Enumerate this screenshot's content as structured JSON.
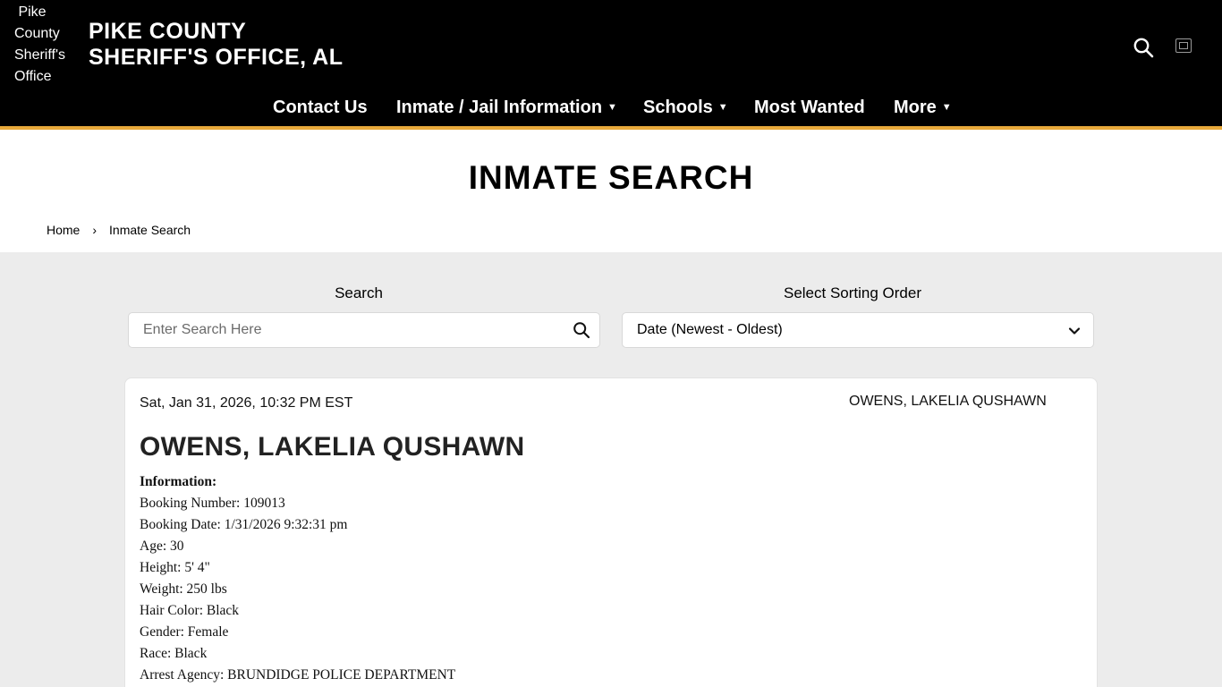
{
  "header": {
    "logo_alt": "Pike County Sheriff's Office",
    "title_line1": "PIKE COUNTY",
    "title_line2": "SHERIFF'S OFFICE, AL",
    "accent_color": "#e8a93a",
    "icons": [
      "search-icon",
      "broken-image-icon"
    ]
  },
  "nav": {
    "items": [
      {
        "label": "Contact Us",
        "has_dropdown": false
      },
      {
        "label": "Inmate / Jail Information",
        "has_dropdown": true
      },
      {
        "label": "Schools",
        "has_dropdown": true
      },
      {
        "label": "Most Wanted",
        "has_dropdown": false
      },
      {
        "label": "More",
        "has_dropdown": true
      }
    ]
  },
  "page": {
    "title": "INMATE SEARCH",
    "breadcrumb": [
      "Home",
      "Inmate Search"
    ]
  },
  "search": {
    "label": "Search",
    "placeholder": "Enter Search Here",
    "value": ""
  },
  "sort": {
    "label": "Select Sorting Order",
    "selected": "Date (Newest - Oldest)"
  },
  "inmate": {
    "date": "Sat, Jan 31, 2026, 10:32 PM EST",
    "photo_alt": "OWENS, LAKELIA QUSHAWN",
    "name": "OWENS, LAKELIA QUSHAWN",
    "info_heading": "Information:",
    "details": [
      "Booking Number: 109013",
      "Booking Date: 1/31/2026 9:32:31 pm",
      "Age: 30",
      "Height: 5' 4\"",
      "Weight: 250 lbs",
      "Hair Color: Black",
      "Gender: Female",
      "Race: Black",
      "Arrest Agency: BRUNDIDGE POLICE DEPARTMENT"
    ]
  }
}
